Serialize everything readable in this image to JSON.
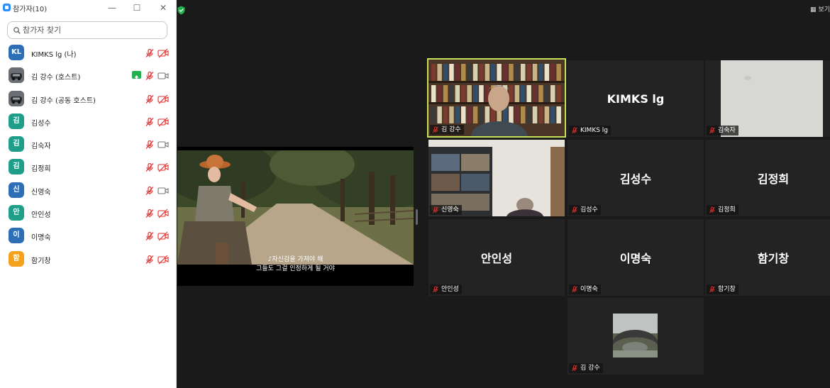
{
  "panel": {
    "title": "참가자(10)",
    "search_placeholder": "참가자 찾기",
    "participants": [
      {
        "name": "KIMKS lg (나)",
        "avatar": "KL",
        "color": "#2d6fb7",
        "mic": "muted",
        "video": "off"
      },
      {
        "name": "김 강수 (호스트)",
        "avatar": "",
        "color": "#5a5d62",
        "mic": "muted",
        "video": "on",
        "sharing": true
      },
      {
        "name": "김 강수 (공동 호스트)",
        "avatar": "",
        "color": "#5a5d62",
        "mic": "muted",
        "video": "off"
      },
      {
        "name": "김성수",
        "avatar": "김",
        "color": "#1f9e8a",
        "mic": "muted",
        "video": "off"
      },
      {
        "name": "김숙자",
        "avatar": "김",
        "color": "#1f9e8a",
        "mic": "muted",
        "video": "on"
      },
      {
        "name": "김정희",
        "avatar": "김",
        "color": "#1f9e8a",
        "mic": "muted",
        "video": "off"
      },
      {
        "name": "신영숙",
        "avatar": "신",
        "color": "#2d6fb7",
        "mic": "muted",
        "video": "on"
      },
      {
        "name": "안인성",
        "avatar": "안",
        "color": "#1f9e8a",
        "mic": "muted",
        "video": "off"
      },
      {
        "name": "이명숙",
        "avatar": "이",
        "color": "#2d6fb7",
        "mic": "muted",
        "video": "off"
      },
      {
        "name": "함기창",
        "avatar": "함",
        "color": "#f4a11f",
        "mic": "muted",
        "video": "off"
      }
    ]
  },
  "meeting": {
    "view_label": "보기",
    "subtitle_line1": "♪자신감을 가져야 해",
    "subtitle_line2": "그들도 그걸 인정하게 될 거야",
    "tiles": [
      {
        "name": "김 강수",
        "big": "",
        "kind": "bookshelf",
        "active": true
      },
      {
        "name": "KIMKS lg",
        "big": "KIMKS lg",
        "kind": "name"
      },
      {
        "name": "김숙자",
        "big": "",
        "kind": "wall"
      },
      {
        "name": "신영숙",
        "big": "",
        "kind": "room"
      },
      {
        "name": "김성수",
        "big": "김성수",
        "kind": "name"
      },
      {
        "name": "김정희",
        "big": "김정희",
        "kind": "name"
      },
      {
        "name": "안인성",
        "big": "안인성",
        "kind": "name"
      },
      {
        "name": "이명숙",
        "big": "이명숙",
        "kind": "name"
      },
      {
        "name": "함기창",
        "big": "함기창",
        "kind": "name"
      },
      {
        "name": "김 강수",
        "big": "",
        "kind": "bridge"
      }
    ]
  },
  "colors": {
    "active_speaker": "#c6e05a",
    "muted_icon": "#e0312e",
    "panel_bg": "#ffffff",
    "meeting_bg": "#1a1a1a"
  }
}
